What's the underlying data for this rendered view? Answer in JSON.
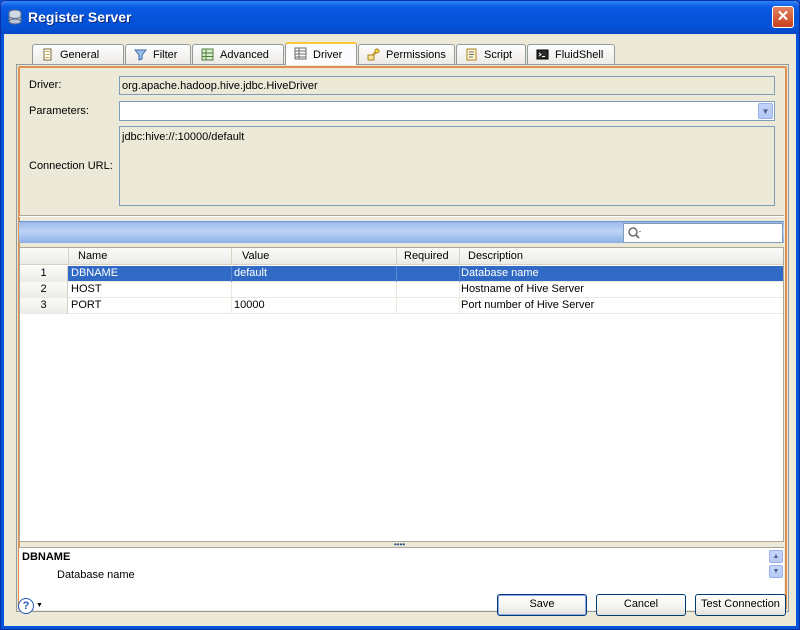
{
  "window": {
    "title": "Register Server"
  },
  "tabs": [
    {
      "label": "General",
      "icon": "general-icon"
    },
    {
      "label": "Filter",
      "icon": "filter-icon"
    },
    {
      "label": "Advanced",
      "icon": "advanced-icon"
    },
    {
      "label": "Driver",
      "icon": "driver-icon",
      "active": true
    },
    {
      "label": "Permissions",
      "icon": "permissions-icon"
    },
    {
      "label": "Script",
      "icon": "script-icon"
    },
    {
      "label": "FluidShell",
      "icon": "fluidshell-icon"
    }
  ],
  "form": {
    "driver_label": "Driver:",
    "driver_value": "org.apache.hadoop.hive.jdbc.HiveDriver",
    "parameters_label": "Parameters:",
    "parameters_value": "",
    "connection_url_label": "Connection URL:",
    "connection_url_value": "jdbc:hive://:10000/default"
  },
  "search": {
    "placeholder": ""
  },
  "table": {
    "columns": [
      "Name",
      "Value",
      "Required",
      "Description"
    ],
    "rows": [
      {
        "num": "1",
        "name": "DBNAME",
        "value": "default",
        "required": "",
        "description": "Database name",
        "selected": true
      },
      {
        "num": "2",
        "name": "HOST",
        "value": "",
        "required": "",
        "description": "Hostname of Hive Server"
      },
      {
        "num": "3",
        "name": "PORT",
        "value": "10000",
        "required": "",
        "description": "Port number of Hive Server"
      }
    ]
  },
  "detail": {
    "title": "DBNAME",
    "body": "Database name"
  },
  "buttons": {
    "save": "Save",
    "cancel": "Cancel",
    "test": "Test Connection"
  },
  "colors": {
    "selection": "#316ac5",
    "tab_highlight": "#ffc83c",
    "frame": "#e28f52",
    "titlebar": "#0453d9"
  }
}
